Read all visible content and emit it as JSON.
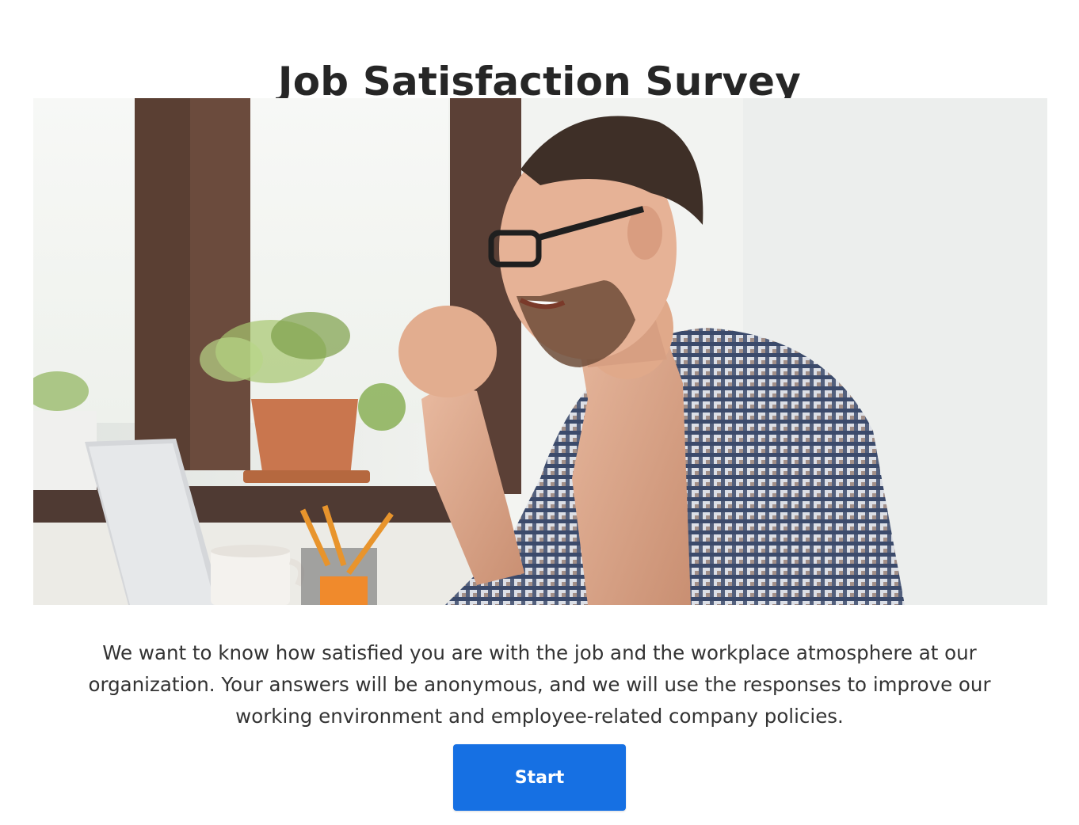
{
  "survey": {
    "title": "Job Satisfaction Survey",
    "description": "We want to know how satisfied you are with the job and the workplace atmosphere at our organization. Your answers will be anonymous, and we will use the responses to improve our working environment and employee-related company policies.",
    "start_label": "Start"
  },
  "colors": {
    "button_background": "#1670e3",
    "button_text": "#ffffff",
    "title_text": "#262626",
    "body_text": "#333333"
  },
  "hero_image": {
    "icon": "photo-excited-man-at-laptop"
  }
}
